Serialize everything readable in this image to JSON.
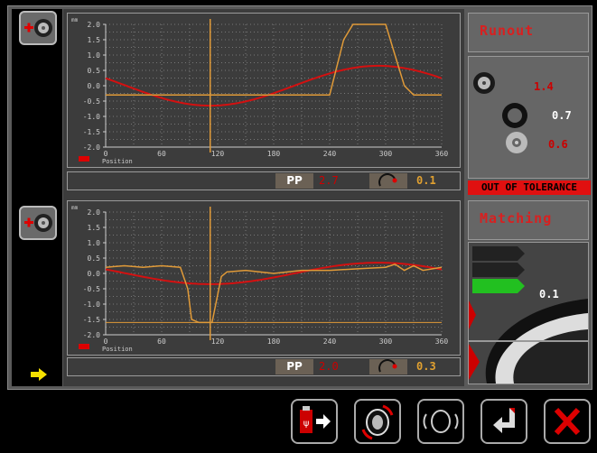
{
  "colors": {
    "background": "#000000",
    "panel": "#5a5a5a",
    "plot_bg": "#3c3c3c",
    "measured": "#e09a38",
    "sine": "#d41010",
    "accent_red": "#d82020",
    "ok_green": "#22c020"
  },
  "left_bar": {
    "top_icon": "wheel-add-icon",
    "bottom_icon": "wheel-add-icon",
    "arrow_icon": "yellow-right-arrow-icon"
  },
  "runout": {
    "title": "Runout",
    "assembly_value": "1.4",
    "tyre_value": "0.7",
    "rim_value": "0.6",
    "status": "OUT OF TOLERANCE"
  },
  "matching": {
    "title": "Matching",
    "green_value": "0.1"
  },
  "chart_data": [
    {
      "type": "line",
      "unit_label": "mm",
      "legend_label": "Position",
      "ylim": [
        -2.0,
        2.0
      ],
      "xlim": [
        0,
        360
      ],
      "yticks": [
        "2.0",
        "1.5",
        "1.0",
        "0.5",
        "0.0",
        "-0.5",
        "-1.0",
        "-1.5",
        "-2.0"
      ],
      "xticks": [
        "0",
        "60",
        "120",
        "180",
        "240",
        "300",
        "360"
      ],
      "grid": true,
      "marker_x": 112,
      "series": [
        {
          "style": "sine",
          "amplitude": 0.65,
          "phase_min_x": 112,
          "offset": 0.0
        },
        {
          "style": "measured",
          "x": [
            0,
            30,
            60,
            90,
            112,
            150,
            200,
            240,
            255,
            265,
            275,
            300,
            310,
            320,
            330,
            340,
            360
          ],
          "y": [
            -0.3,
            -0.3,
            -0.3,
            -0.3,
            -0.3,
            -0.3,
            -0.3,
            -0.3,
            1.5,
            2.0,
            2.0,
            2.0,
            1.0,
            0.0,
            -0.3,
            -0.3,
            -0.3
          ]
        }
      ],
      "pp_label": "PP",
      "pp_value": "2.7",
      "rotation_value": "0.1"
    },
    {
      "type": "line",
      "unit_label": "mm",
      "legend_label": "Position",
      "ylim": [
        -2.0,
        2.0
      ],
      "xlim": [
        0,
        360
      ],
      "yticks": [
        "2.0",
        "1.5",
        "1.0",
        "0.5",
        "0.0",
        "-0.5",
        "-1.0",
        "-1.5",
        "-2.0"
      ],
      "xticks": [
        "0",
        "60",
        "120",
        "180",
        "240",
        "300",
        "360"
      ],
      "grid": true,
      "marker_x": 112,
      "series": [
        {
          "style": "sine",
          "amplitude": 0.35,
          "phase_min_x": 112,
          "offset": 0.0
        },
        {
          "style": "measured",
          "x": [
            0,
            20,
            40,
            60,
            80,
            88,
            92,
            100,
            106,
            110,
            114,
            118,
            124,
            130,
            150,
            180,
            210,
            240,
            270,
            300,
            310,
            320,
            330,
            340,
            360
          ],
          "y": [
            0.2,
            0.25,
            0.2,
            0.25,
            0.2,
            -0.5,
            -1.5,
            -1.6,
            -1.6,
            -1.6,
            -1.6,
            -1.0,
            -0.1,
            0.05,
            0.1,
            0.0,
            0.1,
            0.1,
            0.15,
            0.2,
            0.3,
            0.1,
            0.25,
            0.1,
            0.2
          ]
        },
        {
          "style": "flat",
          "y": -1.6
        }
      ],
      "pp_label": "PP",
      "pp_value": "2.0",
      "rotation_value": "0.3"
    }
  ],
  "toolbar": {
    "buttons": [
      "usb-export-icon",
      "wheel-rotate-icon",
      "tyre-icon",
      "confirm-enter-icon",
      "close-icon"
    ]
  }
}
